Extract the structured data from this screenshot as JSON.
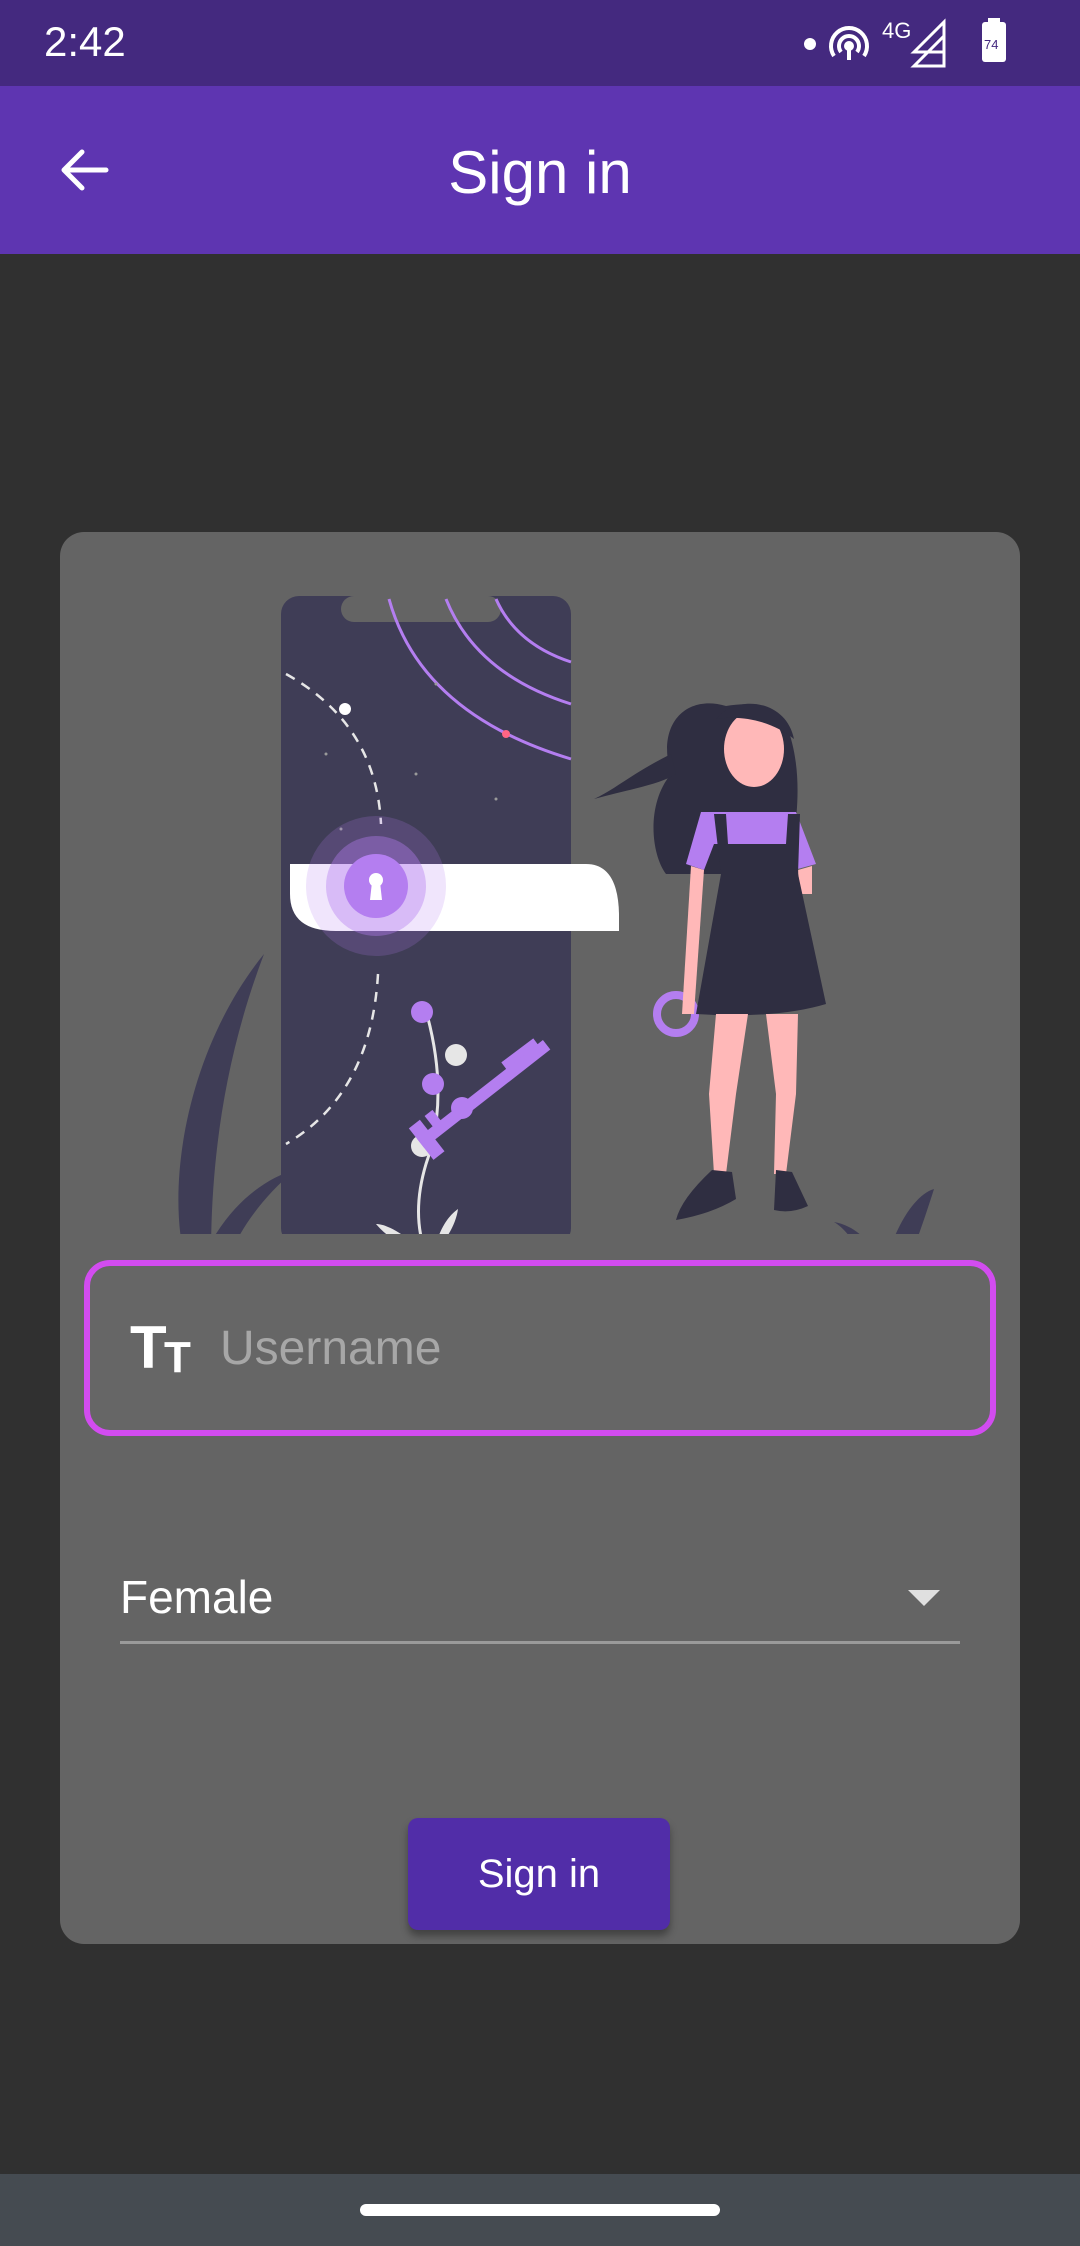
{
  "status_bar": {
    "time": "2:42",
    "network": "4G",
    "battery": "74",
    "icons": [
      "notification-dot-icon",
      "hotspot-icon",
      "signal-icon",
      "battery-icon"
    ]
  },
  "app_bar": {
    "title": "Sign in",
    "back_icon": "arrow-left-icon"
  },
  "form": {
    "username": {
      "placeholder": "Username",
      "value": "",
      "icon": "text-fields-icon",
      "focus_color": "#d24cf0"
    },
    "gender": {
      "selected": "Female"
    },
    "submit_label": "Sign in"
  },
  "colors": {
    "status_bar": "#44297f",
    "app_bar": "#5e35b1",
    "background": "#303030",
    "card": "#646464",
    "button": "#512da8",
    "accent_purple": "#b47ef0"
  }
}
